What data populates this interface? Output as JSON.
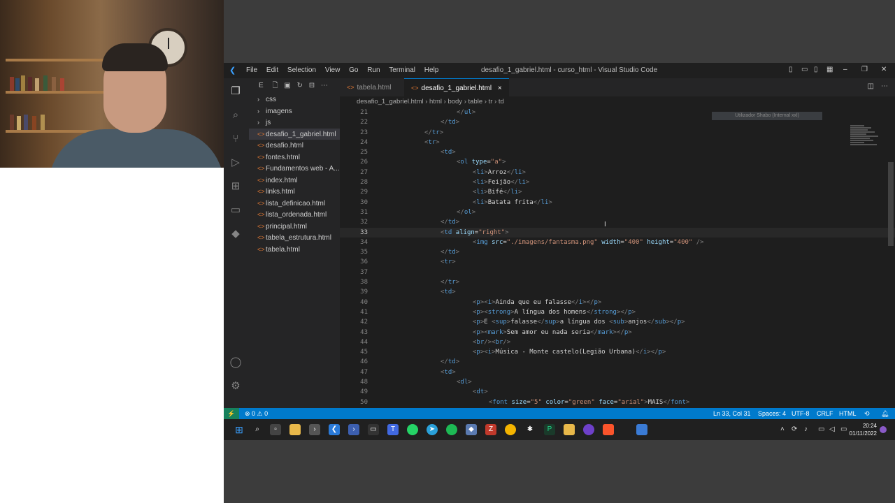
{
  "window": {
    "title": "desafio_1_gabriel.html - curso_html - Visual Studio Code",
    "menu": [
      "File",
      "Edit",
      "Selection",
      "View",
      "Go",
      "Run",
      "Terminal",
      "Help"
    ]
  },
  "sidebar": {
    "header": "E",
    "items": [
      {
        "label": "css",
        "type": "folder"
      },
      {
        "label": "imagens",
        "type": "folder"
      },
      {
        "label": "js",
        "type": "folder"
      },
      {
        "label": "desafio_1_gabriel.html",
        "type": "file"
      },
      {
        "label": "desafio.html",
        "type": "file"
      },
      {
        "label": "fontes.html",
        "type": "file"
      },
      {
        "label": "Fundamentos web - A...",
        "type": "file"
      },
      {
        "label": "index.html",
        "type": "file"
      },
      {
        "label": "links.html",
        "type": "file"
      },
      {
        "label": "lista_definicao.html",
        "type": "file"
      },
      {
        "label": "lista_ordenada.html",
        "type": "file"
      },
      {
        "label": "principal.html",
        "type": "file"
      },
      {
        "label": "tabela_estrutura.html",
        "type": "file"
      },
      {
        "label": "tabela.html",
        "type": "file"
      }
    ]
  },
  "tabs": [
    {
      "label": "tabela.html"
    },
    {
      "label": "desafio_1_gabriel.html",
      "close": "×"
    }
  ],
  "breadcrumb": [
    "desafio_1_gabriel.html",
    "html",
    "body",
    "table",
    "tr",
    "td"
  ],
  "find_hint": "Utilizador Shabo (Internal xxl)",
  "code": [
    {
      "n": "21",
      "indent": 10,
      "text": "</ul>"
    },
    {
      "n": "22",
      "indent": 8,
      "text": "</td>"
    },
    {
      "n": "23",
      "indent": 6,
      "text": "</tr>"
    },
    {
      "n": "24",
      "indent": 6,
      "text": "<tr>"
    },
    {
      "n": "25",
      "indent": 8,
      "text": "<td>"
    },
    {
      "n": "26",
      "indent": 10,
      "text": "<ol type=\"a\">"
    },
    {
      "n": "27",
      "indent": 12,
      "text": "<li>Arroz</li>"
    },
    {
      "n": "28",
      "indent": 12,
      "text": "<li>Feijão</li>"
    },
    {
      "n": "29",
      "indent": 12,
      "text": "<li>Bifé</li>"
    },
    {
      "n": "30",
      "indent": 12,
      "text": "<li>Batata frita</li>"
    },
    {
      "n": "31",
      "indent": 10,
      "text": "</ol>"
    },
    {
      "n": "32",
      "indent": 8,
      "text": "</td>"
    },
    {
      "n": "33",
      "indent": 8,
      "text": "<td align=\"right\">"
    },
    {
      "n": "34",
      "indent": 12,
      "text": "<img src=\"./imagens/fantasma.png\" width=\"400\" height=\"400\" />"
    },
    {
      "n": "35",
      "indent": 8,
      "text": "</td>"
    },
    {
      "n": "36",
      "indent": 8,
      "text": "<tr>"
    },
    {
      "n": "37",
      "indent": 0,
      "text": ""
    },
    {
      "n": "38",
      "indent": 8,
      "text": "</tr>"
    },
    {
      "n": "39",
      "indent": 8,
      "text": "<td>"
    },
    {
      "n": "40",
      "indent": 12,
      "text": "<p><i>Ainda que eu falasse</i></p>"
    },
    {
      "n": "41",
      "indent": 12,
      "text": "<p><strong>A língua dos homens</strong></p>"
    },
    {
      "n": "42",
      "indent": 12,
      "text": "<p>E <sup>falasse</sup>a língua dos <sub>anjos</sub></p>"
    },
    {
      "n": "43",
      "indent": 12,
      "text": "<p><mark>Sem amor eu nada seria</mark></p>"
    },
    {
      "n": "44",
      "indent": 12,
      "text": "<br/><br/>"
    },
    {
      "n": "45",
      "indent": 12,
      "text": "<p><i>Música - Monte castelo(Legião Urbana)</i></p>"
    },
    {
      "n": "46",
      "indent": 8,
      "text": "</td>"
    },
    {
      "n": "47",
      "indent": 8,
      "text": "<td>"
    },
    {
      "n": "48",
      "indent": 10,
      "text": "<dl>"
    },
    {
      "n": "49",
      "indent": 12,
      "text": "<dt>"
    },
    {
      "n": "50",
      "indent": 14,
      "text": "<font size=\"5\" color=\"green\" face=\"arial\">MAIS</font>"
    }
  ],
  "current_line": "33",
  "status": {
    "errors": "⊗ 0 ⚠ 0",
    "position": "Ln 33, Col 31",
    "spaces": "Spaces: 4",
    "encoding": "UTF-8",
    "eol": "CRLF",
    "language": "HTML"
  },
  "taskbar": {
    "time": "20:24",
    "date": "01/11/2022"
  },
  "colors": {
    "accent": "#007acc",
    "editor_bg": "#1e1e1e",
    "sidebar_bg": "#252526"
  }
}
